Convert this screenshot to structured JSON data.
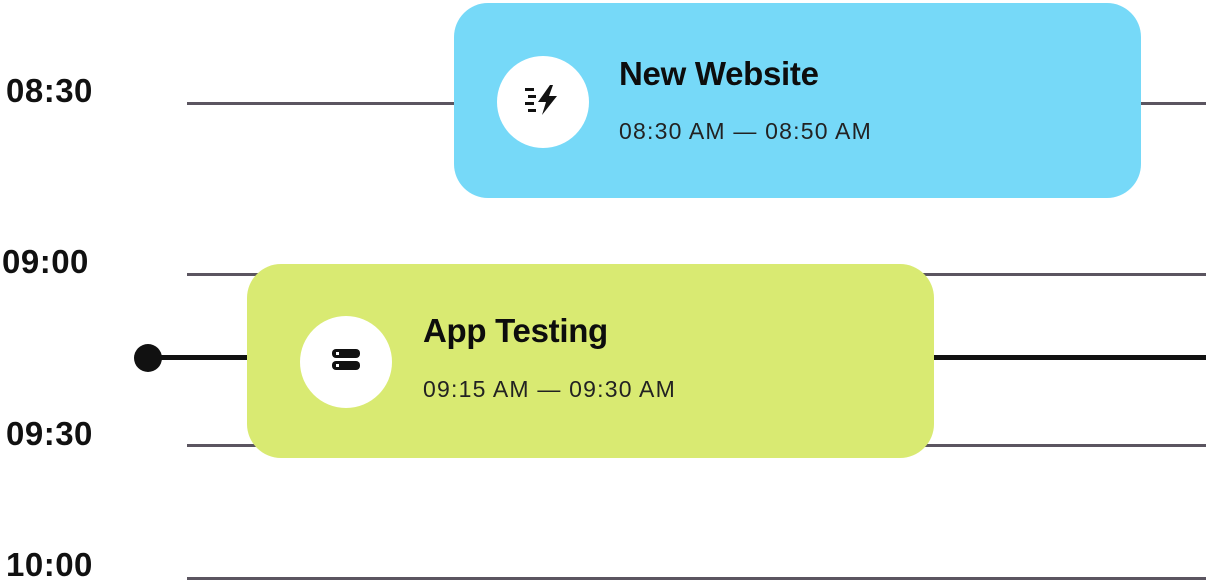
{
  "timeline": {
    "slots": [
      {
        "label": "08:30"
      },
      {
        "label": "09:00"
      },
      {
        "label": "09:30"
      },
      {
        "label": "10:00"
      }
    ]
  },
  "events": [
    {
      "title": "New Website",
      "time_range": "08:30 AM — 08:50 AM",
      "icon": "lightning-fast-icon",
      "color": "#76d9f8"
    },
    {
      "title": "App Testing",
      "time_range": "09:15 AM — 09:30 AM",
      "icon": "server-icon",
      "color": "#d9ea72"
    }
  ],
  "now_indicator": {
    "color": "#111111"
  }
}
